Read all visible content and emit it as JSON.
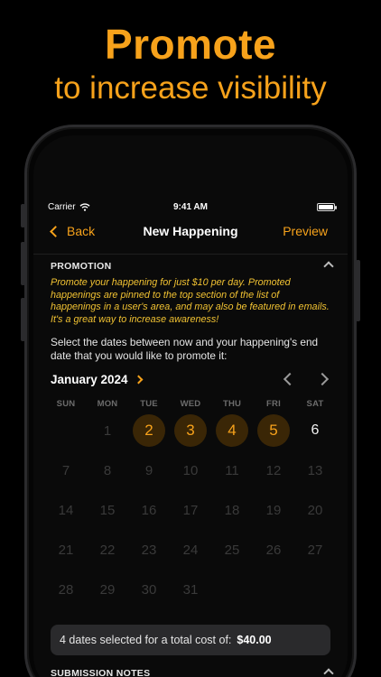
{
  "marketing": {
    "headline": "Promote",
    "subheadline": "to increase visibility"
  },
  "status_bar": {
    "carrier": "Carrier",
    "time": "9:41 AM"
  },
  "nav": {
    "back_label": "Back",
    "title": "New Happening",
    "preview_label": "Preview"
  },
  "promotion": {
    "header": "PROMOTION",
    "description": "Promote your happening for just $10 per day. Promoted happenings are pinned to the top section of the list of happenings in a user's area, and may also be featured in emails. It's a great way to increase awareness!",
    "instruction": "Select the dates between now and your happening's end date that you would like to promote it:"
  },
  "calendar": {
    "month": "January 2024",
    "weekdays": [
      "SUN",
      "MON",
      "TUE",
      "WED",
      "THU",
      "FRI",
      "SAT"
    ],
    "days": [
      {
        "label": "",
        "state": "empty"
      },
      {
        "label": "1",
        "state": "disabled"
      },
      {
        "label": "2",
        "state": "selected"
      },
      {
        "label": "3",
        "state": "selected"
      },
      {
        "label": "4",
        "state": "selected"
      },
      {
        "label": "5",
        "state": "selected"
      },
      {
        "label": "6",
        "state": "available"
      },
      {
        "label": "7",
        "state": "disabled"
      },
      {
        "label": "8",
        "state": "disabled"
      },
      {
        "label": "9",
        "state": "disabled"
      },
      {
        "label": "10",
        "state": "disabled"
      },
      {
        "label": "11",
        "state": "disabled"
      },
      {
        "label": "12",
        "state": "disabled"
      },
      {
        "label": "13",
        "state": "disabled"
      },
      {
        "label": "14",
        "state": "disabled"
      },
      {
        "label": "15",
        "state": "disabled"
      },
      {
        "label": "16",
        "state": "disabled"
      },
      {
        "label": "17",
        "state": "disabled"
      },
      {
        "label": "18",
        "state": "disabled"
      },
      {
        "label": "19",
        "state": "disabled"
      },
      {
        "label": "20",
        "state": "disabled"
      },
      {
        "label": "21",
        "state": "disabled"
      },
      {
        "label": "22",
        "state": "disabled"
      },
      {
        "label": "23",
        "state": "disabled"
      },
      {
        "label": "24",
        "state": "disabled"
      },
      {
        "label": "25",
        "state": "disabled"
      },
      {
        "label": "26",
        "state": "disabled"
      },
      {
        "label": "27",
        "state": "disabled"
      },
      {
        "label": "28",
        "state": "disabled"
      },
      {
        "label": "29",
        "state": "disabled"
      },
      {
        "label": "30",
        "state": "disabled"
      },
      {
        "label": "31",
        "state": "disabled"
      }
    ]
  },
  "summary": {
    "text": "4 dates selected for a total cost of:",
    "amount": "$40.00"
  },
  "next_section": {
    "header": "SUBMISSION NOTES"
  },
  "colors": {
    "accent": "#f7a21b",
    "promo_text": "#f1c232",
    "selected_bg": "#3a2606"
  }
}
